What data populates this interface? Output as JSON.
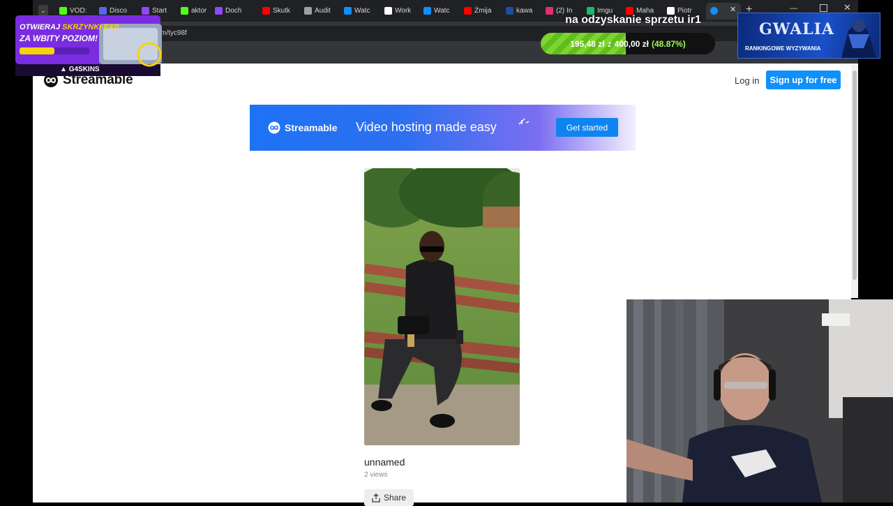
{
  "browser": {
    "tabs": [
      {
        "label": "VOD:",
        "icon": "kick-icon",
        "color": "#53fc18"
      },
      {
        "label": "Disco",
        "icon": "discord-icon",
        "color": "#5865f2"
      },
      {
        "label": "Start",
        "icon": "twitch-icon",
        "color": "#9146ff"
      },
      {
        "label": "aktor",
        "icon": "kick-icon",
        "color": "#53fc18"
      },
      {
        "label": "Doch",
        "icon": "twitch-icon",
        "color": "#9146ff"
      },
      {
        "label": "Skutk",
        "icon": "youtube-icon",
        "color": "#ff0000"
      },
      {
        "label": "Audit",
        "icon": "globe-icon",
        "color": "#9aa0a6"
      },
      {
        "label": "Watc",
        "icon": "streamable-icon",
        "color": "#0f90fa"
      },
      {
        "label": "Work",
        "icon": "tiktok-icon",
        "color": "#ffffff"
      },
      {
        "label": "Watc",
        "icon": "streamable-icon",
        "color": "#0f90fa"
      },
      {
        "label": "Żmija",
        "icon": "youtube-icon",
        "color": "#ff0000"
      },
      {
        "label": "kawa",
        "icon": "news-icon",
        "color": "#1c4f9c"
      },
      {
        "label": "(2) In",
        "icon": "instagram-icon",
        "color": "#e1306c"
      },
      {
        "label": "Imgu",
        "icon": "imgur-icon",
        "color": "#1bb76e"
      },
      {
        "label": "Maha",
        "icon": "youtube-icon",
        "color": "#ff0000"
      },
      {
        "label": "Piotr",
        "icon": "x-icon",
        "color": "#ffffff"
      }
    ],
    "url_fragment": "m/tyc98f"
  },
  "site": {
    "logo": "Streamable",
    "login": "Log in",
    "signup": "Sign up for free",
    "banner": {
      "brand": "Streamable",
      "headline": "Video hosting made easy",
      "cta": "Get started"
    }
  },
  "video": {
    "title": "unnamed",
    "views": "2 views",
    "share": "Share"
  },
  "overlay": {
    "promo_line1": "OTWIERAJ",
    "promo_highlight": "SKRZYNKI EXP",
    "promo_line2": "ZA WBITY POZIOM!",
    "promo_brand": "G4SKINS",
    "goal_title": "na odzyskanie sprzetu ir1",
    "goal_current": "195,48 zł",
    "goal_sep": "z",
    "goal_target": "400,00 zł",
    "goal_percent_label": "(48.87%)",
    "goal_progress": 0.4887,
    "guild_title": "GWALIA",
    "guild_subtitle": "RANKINGOWE WYZYWANIA"
  }
}
